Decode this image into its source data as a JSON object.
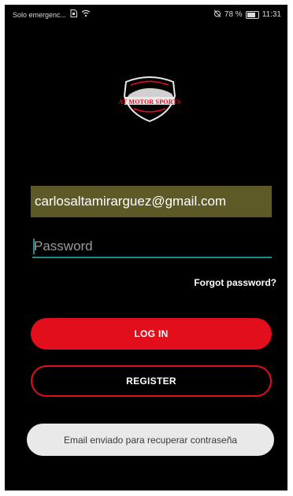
{
  "status_bar": {
    "carrier": "Solo emergenc...",
    "battery_text": "78 %",
    "time": "11:31",
    "battery_level": 0.78,
    "icons": [
      "sim-icon",
      "wifi-icon",
      "alarm-off-icon",
      "battery-icon"
    ]
  },
  "brand": {
    "logo_text": "AT MOTOR SPORTS",
    "accent_color": "#e30e1c"
  },
  "form": {
    "email_value": "carlosaltamirarguez@gmail.com",
    "password_placeholder": "Password",
    "forgot_label": "Forgot password?"
  },
  "buttons": {
    "login_label": "LOG IN",
    "register_label": "REGISTER"
  },
  "toast": {
    "message": "Email enviado para recuperar contraseña"
  }
}
